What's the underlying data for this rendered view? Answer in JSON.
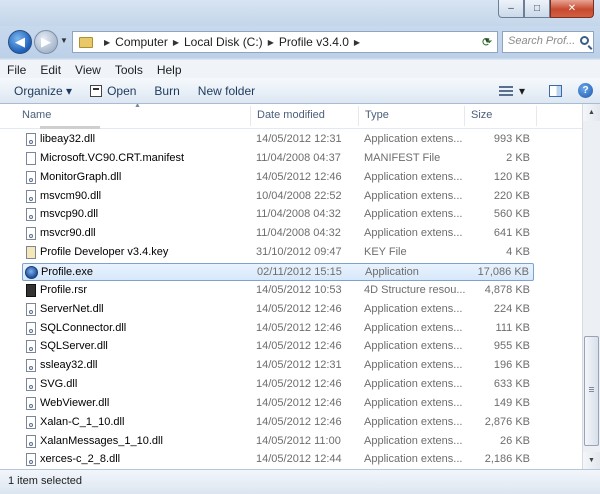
{
  "window": {
    "caption": {
      "minimize": "‒",
      "maximize": "□",
      "close": "✕"
    }
  },
  "nav": {
    "back_glyph": "◀",
    "forward_glyph": "▶",
    "crumbs": [
      "Computer",
      "Local Disk (C:)",
      "Profile v3.4.0"
    ],
    "search_placeholder": "Search Prof..."
  },
  "menu": [
    "File",
    "Edit",
    "View",
    "Tools",
    "Help"
  ],
  "commands": {
    "organize": "Organize ▾",
    "open": "Open",
    "burn": "Burn",
    "new_folder": "New folder",
    "view_menu": "▾",
    "help": "?"
  },
  "columns": {
    "name": "Name",
    "date": "Date modified",
    "type": "Type",
    "size": "Size"
  },
  "files": [
    {
      "name": "libeay32.dll",
      "date": "14/05/2012 12:31",
      "type": "Application extens...",
      "size": "993 KB",
      "icon": "dll"
    },
    {
      "name": "Microsoft.VC90.CRT.manifest",
      "date": "11/04/2008 04:37",
      "type": "MANIFEST File",
      "size": "2 KB",
      "icon": "file"
    },
    {
      "name": "MonitorGraph.dll",
      "date": "14/05/2012 12:46",
      "type": "Application extens...",
      "size": "120 KB",
      "icon": "dll"
    },
    {
      "name": "msvcm90.dll",
      "date": "10/04/2008 22:52",
      "type": "Application extens...",
      "size": "220 KB",
      "icon": "dll"
    },
    {
      "name": "msvcp90.dll",
      "date": "11/04/2008 04:32",
      "type": "Application extens...",
      "size": "560 KB",
      "icon": "dll"
    },
    {
      "name": "msvcr90.dll",
      "date": "11/04/2008 04:32",
      "type": "Application extens...",
      "size": "641 KB",
      "icon": "dll"
    },
    {
      "name": "Profile Developer v3.4.key",
      "date": "31/10/2012 09:47",
      "type": "KEY File",
      "size": "4 KB",
      "icon": "key"
    },
    {
      "name": "Profile.exe",
      "date": "02/11/2012 15:15",
      "type": "Application",
      "size": "17,086 KB",
      "icon": "exe",
      "selected": true
    },
    {
      "name": "Profile.rsr",
      "date": "14/05/2012 10:53",
      "type": "4D Structure resou...",
      "size": "4,878 KB",
      "icon": "rsr"
    },
    {
      "name": "ServerNet.dll",
      "date": "14/05/2012 12:46",
      "type": "Application extens...",
      "size": "224 KB",
      "icon": "dll"
    },
    {
      "name": "SQLConnector.dll",
      "date": "14/05/2012 12:46",
      "type": "Application extens...",
      "size": "111 KB",
      "icon": "dll"
    },
    {
      "name": "SQLServer.dll",
      "date": "14/05/2012 12:46",
      "type": "Application extens...",
      "size": "955 KB",
      "icon": "dll"
    },
    {
      "name": "ssleay32.dll",
      "date": "14/05/2012 12:31",
      "type": "Application extens...",
      "size": "196 KB",
      "icon": "dll"
    },
    {
      "name": "SVG.dll",
      "date": "14/05/2012 12:46",
      "type": "Application extens...",
      "size": "633 KB",
      "icon": "dll"
    },
    {
      "name": "WebViewer.dll",
      "date": "14/05/2012 12:46",
      "type": "Application extens...",
      "size": "149 KB",
      "icon": "dll"
    },
    {
      "name": "Xalan-C_1_10.dll",
      "date": "14/05/2012 12:46",
      "type": "Application extens...",
      "size": "2,876 KB",
      "icon": "dll"
    },
    {
      "name": "XalanMessages_1_10.dll",
      "date": "14/05/2012 11:00",
      "type": "Application extens...",
      "size": "26 KB",
      "icon": "dll"
    },
    {
      "name": "xerces-c_2_8.dll",
      "date": "14/05/2012 12:44",
      "type": "Application extens...",
      "size": "2,186 KB",
      "icon": "dll"
    }
  ],
  "status": "1 item selected"
}
